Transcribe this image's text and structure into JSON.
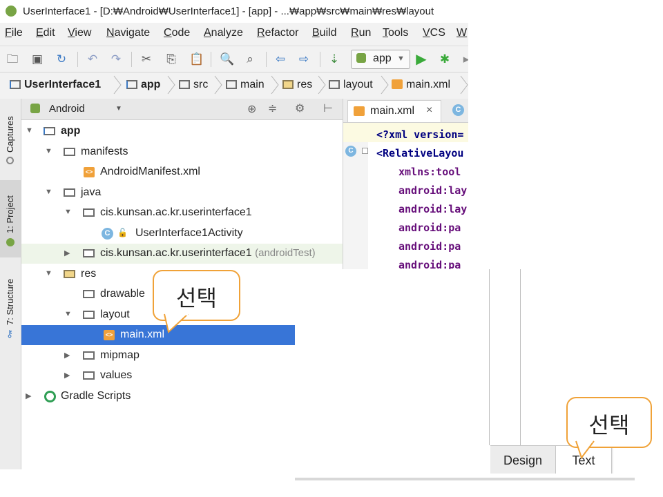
{
  "title_bar": {
    "text": "UserInterface1 - [D:₩Android₩UserInterface1] - [app] - ...₩app₩src₩main₩res₩layout"
  },
  "menu": [
    "File",
    "Edit",
    "View",
    "Navigate",
    "Code",
    "Analyze",
    "Refactor",
    "Build",
    "Run",
    "Tools",
    "VCS",
    "W"
  ],
  "toolbar": {
    "run_config": "app"
  },
  "breadcrumbs": [
    "UserInterface1",
    "app",
    "src",
    "main",
    "res",
    "layout",
    "main.xml"
  ],
  "side_tabs": [
    "Captures",
    "1: Project",
    "7: Structure"
  ],
  "project_panel": {
    "view_selector": "Android",
    "tree": [
      {
        "label": "app",
        "bold": true
      },
      {
        "label": "manifests"
      },
      {
        "label": "AndroidManifest.xml"
      },
      {
        "label": "java"
      },
      {
        "label": "cis.kunsan.ac.kr.userinterface1"
      },
      {
        "label": "UserInterface1Activity"
      },
      {
        "label": "cis.kunsan.ac.kr.userinterface1",
        "suffix": "(androidTest)"
      },
      {
        "label": "res"
      },
      {
        "label": "drawable"
      },
      {
        "label": "layout"
      },
      {
        "label": "main.xml",
        "selected": true
      },
      {
        "label": "mipmap"
      },
      {
        "label": "values"
      },
      {
        "label": "Gradle Scripts"
      }
    ]
  },
  "editor": {
    "tab_label": "main.xml",
    "tab_close": "×",
    "second_tab_icon": "C",
    "lines": [
      "<?xml version=",
      "<RelativeLayou",
      "xmlns:tool",
      "android:lay",
      "android:lay",
      "android:pa",
      "android:pa",
      "android:pa"
    ]
  },
  "design_tabs": {
    "design": "Design",
    "text": "Text"
  },
  "callouts": {
    "first": "선택",
    "second": "선택"
  },
  "colors": {
    "selection": "#3875d7",
    "callout_border": "#f0a238",
    "xml_tag": "#000080",
    "attr": "#660e7a"
  }
}
